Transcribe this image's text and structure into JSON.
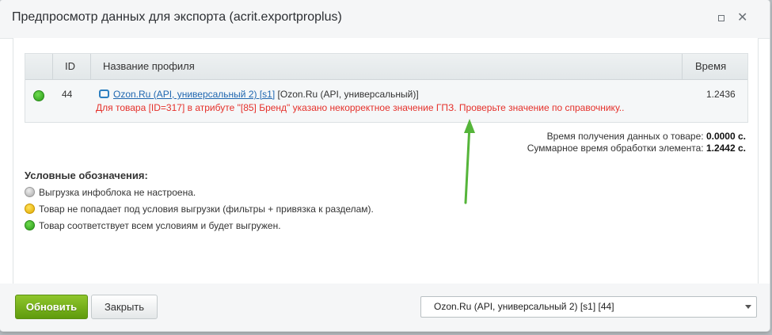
{
  "dialog": {
    "title": "Предпросмотр данных для экспорта (acrit.exportproplus)"
  },
  "table": {
    "headers": {
      "id": "ID",
      "name": "Название профиля",
      "time": "Время"
    },
    "row": {
      "status_color": "#2a9a19",
      "id": "44",
      "profile_link": "Ozon.Ru (API, универсальный 2) [s1]",
      "profile_format": "[Ozon.Ru (API, универсальный)]",
      "error": "Для товара [ID=317] в атрибуте \"[85] Бренд\" указано некорректное значение ГПЗ. Проверьте значение по справочнику..",
      "time": "1.2436"
    }
  },
  "timing": {
    "fetch_label": "Время получения данных о товаре:",
    "fetch_value": "0.0000 с.",
    "total_label": "Суммарное время обработки элемента:",
    "total_value": "1.2442 с."
  },
  "legend": {
    "title": "Условные обозначения:",
    "items": [
      {
        "color": "gray",
        "text": "Выгрузка инфоблока не настроена."
      },
      {
        "color": "yellow",
        "text": "Товар не попадает под условия выгрузки (фильтры + привязка к разделам)."
      },
      {
        "color": "green",
        "text": "Товар соответствует всем условиям и будет выгружен."
      }
    ]
  },
  "footer": {
    "refresh_label": "Обновить",
    "close_label": "Закрыть",
    "profile_select_value": "Ozon.Ru (API, универсальный 2) [s1] [44]"
  },
  "colors": {
    "accent_green": "#6fb01d",
    "error_red": "#e5302a",
    "link_blue": "#2067b0",
    "annotation_arrow": "#55b53a"
  }
}
